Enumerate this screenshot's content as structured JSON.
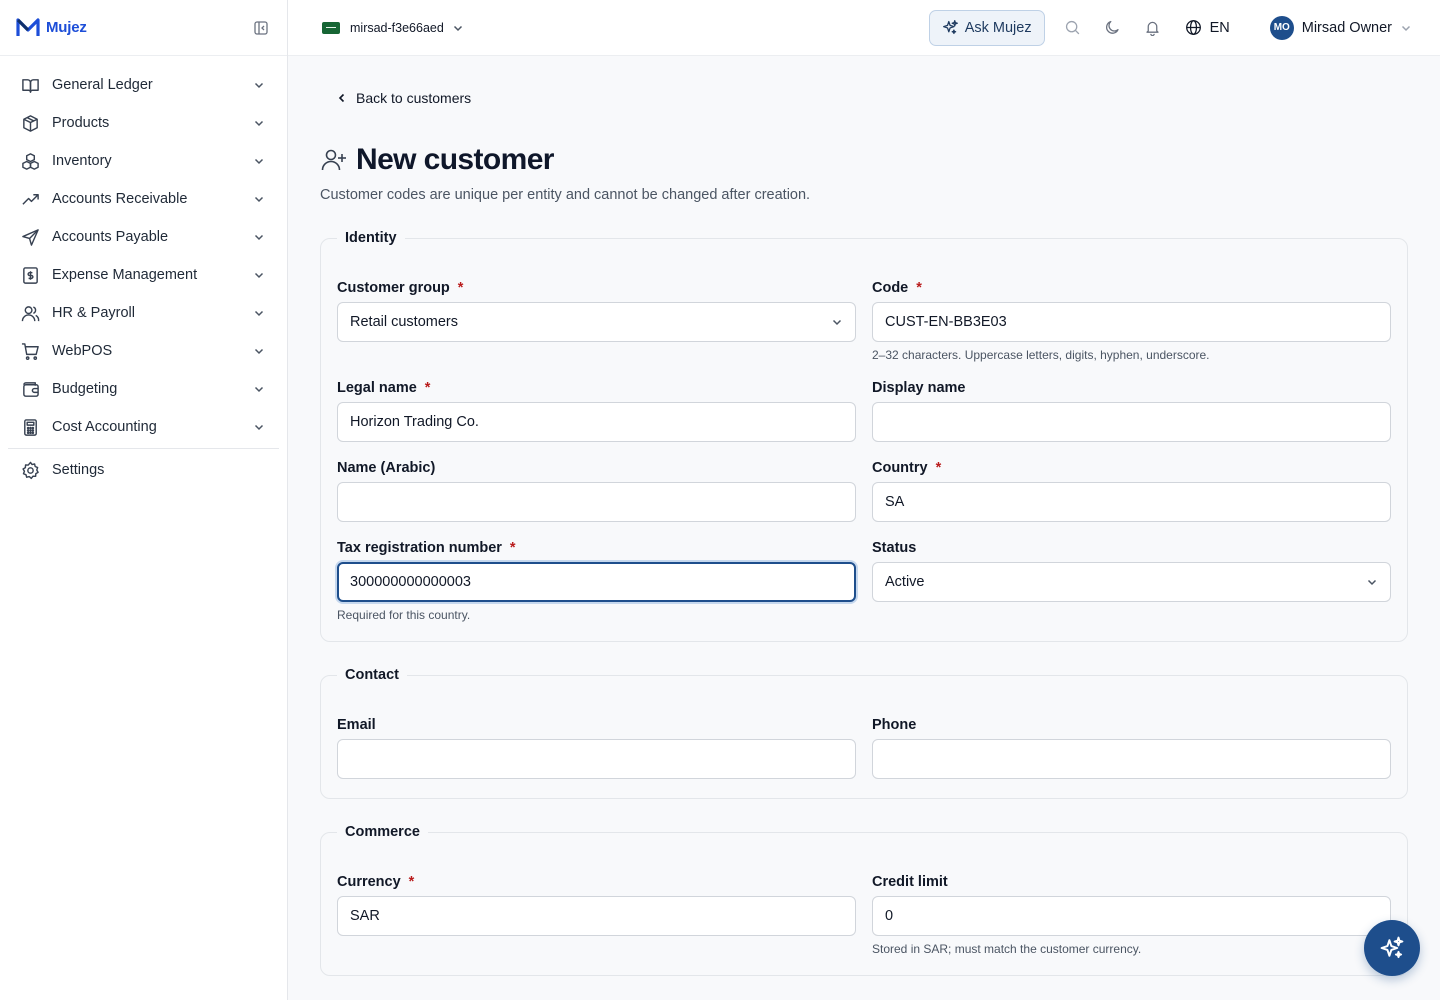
{
  "brand": {
    "name": "Mujez"
  },
  "sidebar": {
    "items": [
      {
        "label": "General Ledger",
        "icon": "book-open-icon"
      },
      {
        "label": "Products",
        "icon": "package-icon"
      },
      {
        "label": "Inventory",
        "icon": "boxes-icon"
      },
      {
        "label": "Accounts Receivable",
        "icon": "trending-up-icon"
      },
      {
        "label": "Accounts Payable",
        "icon": "send-icon"
      },
      {
        "label": "Expense Management",
        "icon": "receipt-icon"
      },
      {
        "label": "HR & Payroll",
        "icon": "users-icon"
      },
      {
        "label": "WebPOS",
        "icon": "cart-icon"
      },
      {
        "label": "Budgeting",
        "icon": "wallet-icon"
      },
      {
        "label": "Cost Accounting",
        "icon": "calculator-icon"
      }
    ],
    "settings": {
      "label": "Settings",
      "icon": "gear-icon"
    }
  },
  "topbar": {
    "entity": "mirsad-f3e66aed",
    "ask_label": "Ask Mujez",
    "language": "EN",
    "user_initials": "MO",
    "user_name": "Mirsad Owner"
  },
  "page": {
    "back_label": "Back to customers",
    "title": "New customer",
    "subtitle": "Customer codes are unique per entity and cannot be changed after creation."
  },
  "sections": {
    "identity": {
      "legend": "Identity",
      "customer_group": {
        "label": "Customer group",
        "value": "Retail customers"
      },
      "code": {
        "label": "Code",
        "value": "CUST-EN-BB3E03",
        "hint": "2–32 characters. Uppercase letters, digits, hyphen, underscore."
      },
      "legal_name": {
        "label": "Legal name",
        "value": "Horizon Trading Co."
      },
      "display_name": {
        "label": "Display name",
        "value": ""
      },
      "name_arabic": {
        "label": "Name (Arabic)",
        "value": ""
      },
      "country": {
        "label": "Country",
        "value": "SA"
      },
      "tax_number": {
        "label": "Tax registration number",
        "value": "300000000000003",
        "hint": "Required for this country."
      },
      "status": {
        "label": "Status",
        "value": "Active"
      }
    },
    "contact": {
      "legend": "Contact",
      "email": {
        "label": "Email",
        "value": ""
      },
      "phone": {
        "label": "Phone",
        "value": ""
      }
    },
    "commerce": {
      "legend": "Commerce",
      "currency": {
        "label": "Currency",
        "value": "SAR"
      },
      "credit_limit": {
        "label": "Credit limit",
        "value": "0",
        "hint": "Stored in SAR; must match the customer currency."
      }
    }
  },
  "required_marker": "*",
  "colors": {
    "accent": "#1e4e8c",
    "brand": "#1d4ed8",
    "required": "#b91c1c"
  }
}
